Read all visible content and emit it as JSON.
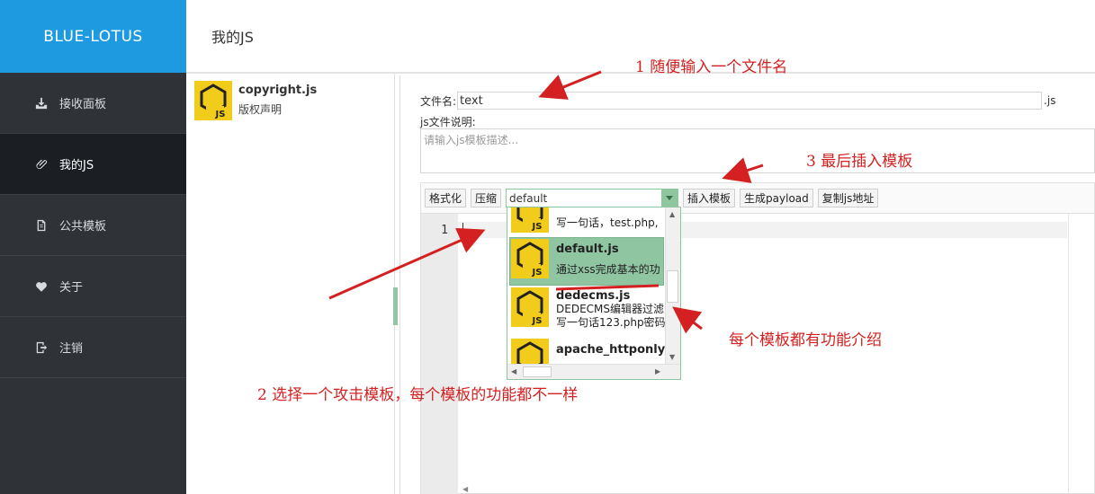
{
  "sidebar": {
    "brand": "BLUE-LOTUS",
    "items": [
      {
        "label": "接收面板",
        "icon": "inbox-download-icon"
      },
      {
        "label": "我的JS",
        "icon": "paperclip-icon"
      },
      {
        "label": "公共模板",
        "icon": "document-icon"
      },
      {
        "label": "关于",
        "icon": "heart-icon"
      },
      {
        "label": "注销",
        "icon": "logout-icon"
      }
    ],
    "active_index": 1
  },
  "header": {
    "title": "我的JS"
  },
  "files": [
    {
      "name": "copyright.js",
      "desc": "版权声明"
    }
  ],
  "form": {
    "filename_label": "文件名:",
    "filename_value": "text",
    "filename_suffix": ".js",
    "desc_label": "js文件说明:",
    "desc_placeholder": "请输入js模板描述..."
  },
  "toolbar": {
    "format": "格式化",
    "compress": "压缩",
    "template_selected": "default",
    "insert": "插入模板",
    "payload": "生成payload",
    "copy_url": "复制js地址"
  },
  "editor": {
    "line_number": "1"
  },
  "dropdown": {
    "items": [
      {
        "title": "",
        "desc": "写一句话，test.php,"
      },
      {
        "title": "default.js",
        "desc": "通过xss完成基本的功"
      },
      {
        "title": "dedecms.js",
        "desc": "DEDECMS编辑器过滤",
        "desc2": "写一句话123.php密码"
      },
      {
        "title": "apache_httponly_",
        "desc": ""
      }
    ],
    "selected_index": 1
  },
  "annotations": {
    "a1": "1  随便输入一个文件名",
    "a2": "2  选择一个攻击模板，每个模板的功能都不一样",
    "a3": "3  最后插入模板",
    "a4": "每个模板都有功能介绍"
  },
  "colors": {
    "brand_bg": "#1e9be0",
    "sidebar_bg": "#2f3338",
    "sidebar_active_bg": "#1b1e22",
    "selection_green": "#90c5a2",
    "annotation_red": "#d42020",
    "js_badge_yellow": "#f2cc1b"
  }
}
